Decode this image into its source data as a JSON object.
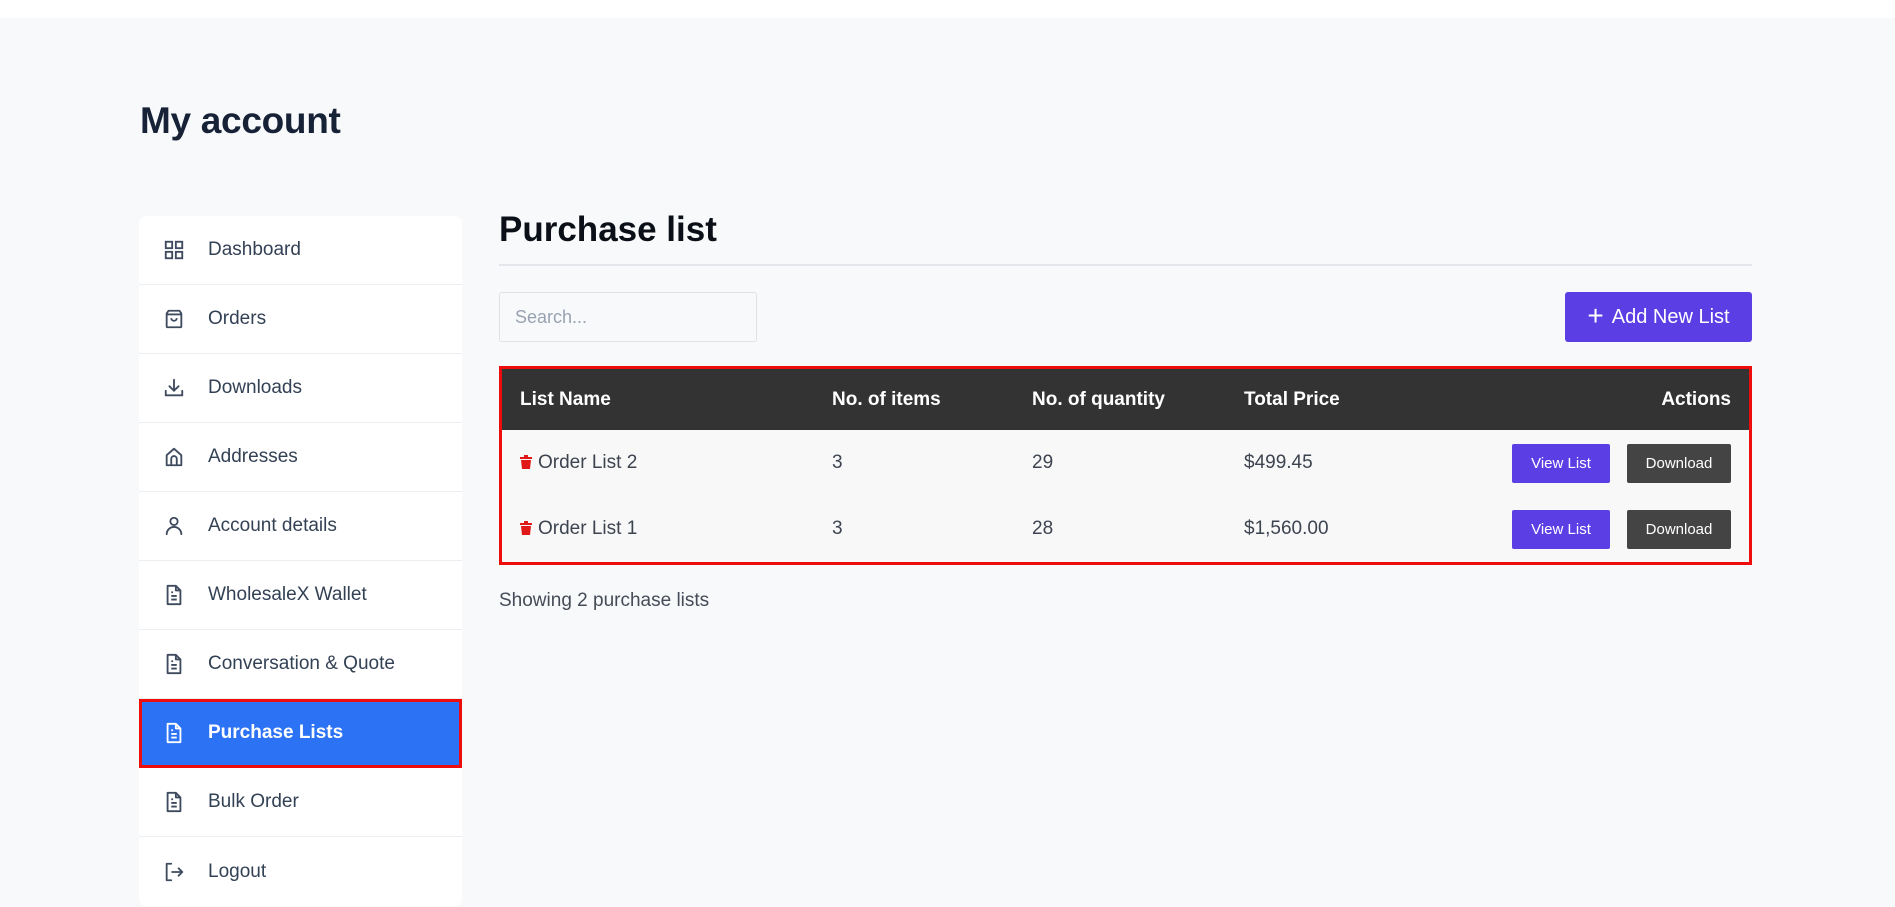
{
  "page": {
    "title": "My account"
  },
  "sidebar": {
    "items": [
      {
        "label": "Dashboard",
        "icon": "grid-icon",
        "active": false
      },
      {
        "label": "Orders",
        "icon": "shopping-bag-icon",
        "active": false
      },
      {
        "label": "Downloads",
        "icon": "download-icon",
        "active": false
      },
      {
        "label": "Addresses",
        "icon": "home-icon",
        "active": false
      },
      {
        "label": "Account details",
        "icon": "user-icon",
        "active": false
      },
      {
        "label": "WholesaleX Wallet",
        "icon": "document-icon",
        "active": false
      },
      {
        "label": "Conversation & Quote",
        "icon": "document-icon",
        "active": false
      },
      {
        "label": "Purchase Lists",
        "icon": "document-icon",
        "active": true
      },
      {
        "label": "Bulk Order",
        "icon": "document-icon",
        "active": false
      },
      {
        "label": "Logout",
        "icon": "logout-icon",
        "active": false
      }
    ]
  },
  "main": {
    "title": "Purchase list",
    "search": {
      "placeholder": "Search...",
      "value": ""
    },
    "add_button": {
      "label": "Add New List",
      "icon": "plus-icon"
    },
    "table": {
      "headers": [
        "List Name",
        "No. of items",
        "No. of quantity",
        "Total Price",
        "Actions"
      ],
      "rows": [
        {
          "name": "Order List 2",
          "items": "3",
          "quantity": "29",
          "total": "$499.45",
          "view_label": "View List",
          "download_label": "Download"
        },
        {
          "name": "Order List 1",
          "items": "3",
          "quantity": "28",
          "total": "$1,560.00",
          "view_label": "View List",
          "download_label": "Download"
        }
      ]
    },
    "footer_text": "Showing 2 purchase lists"
  },
  "colors": {
    "accent": "#5b3fe4",
    "active_nav": "#2b72f5",
    "highlight_border": "#ee0d0d",
    "table_header": "#333333",
    "delete_icon": "#e01818"
  }
}
